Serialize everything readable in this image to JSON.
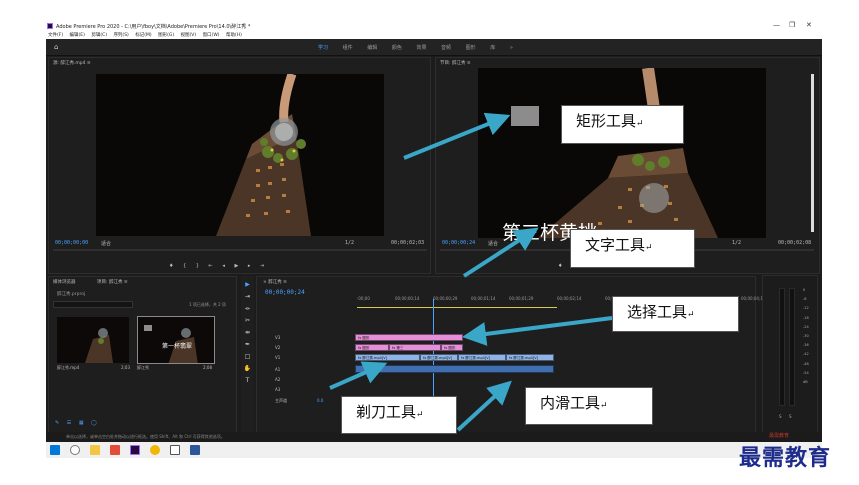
{
  "window": {
    "title": "Adobe Premiere Pro 2020 - C:\\用户\\fboy\\文档\\Adobe\\Premiere Pro\\14.0\\醉江秀 *",
    "controls": [
      "—",
      "❐",
      "✕"
    ]
  },
  "menu": [
    "文件(F)",
    "编辑(E)",
    "剪辑(C)",
    "序列(S)",
    "标记(M)",
    "图形(G)",
    "视图(V)",
    "窗口(W)",
    "帮助(H)"
  ],
  "workspace_tabs": [
    "学习",
    "组件",
    "编辑",
    "颜色",
    "效果",
    "音频",
    "图形",
    "库",
    "»"
  ],
  "source_monitor": {
    "header": "源: 醉江秀.mp4  ≡",
    "timecode_left": "00;00;00;00",
    "fit_label": "适合",
    "scale": "1/2",
    "timecode_right": "00;00;02;03"
  },
  "program_monitor": {
    "header": "节目: 醉江秀  ≡",
    "timecode_left": "00;00;00;24",
    "fit_label": "适合",
    "scale": "1/2",
    "timecode_right": "00;00;02;08",
    "overlay_text": "第三杯黄桃"
  },
  "project_panel": {
    "tabs": [
      "媒体浏览器",
      "项目: 醉江秀  ≡"
    ],
    "project_name": "醉江秀.prproj",
    "selection_info": "1 项已选择，共 2 项",
    "items": [
      {
        "name": "醉江秀.mp4",
        "duration": "2;03"
      },
      {
        "name": "醉江秀",
        "duration": "2;08",
        "overlay": "第一杯翡翠"
      }
    ]
  },
  "timeline": {
    "header": "× 醉江秀  ≡",
    "timecode": "00;00;00;24",
    "ruler": [
      ":00;00",
      "00;00;00;14",
      "00;00;00;29",
      "00;00;01;14",
      "00;00;01;29",
      "00;00;02;14",
      "00;00;02;29",
      "00;00;03;14",
      "00;00;03;29",
      "00;00;04;1"
    ],
    "tracks": [
      "V3",
      "V2",
      "V1",
      "A1",
      "A2",
      "A3",
      "主声道"
    ],
    "master_value": "0.0",
    "clips": {
      "v3": [
        "fx 图形"
      ],
      "v2": [
        "fx 图形",
        "fx 第三",
        "fx 图形"
      ],
      "v1": [
        "fx 醉江秀.mp4[V]",
        "fx 醉江秀.mp4[V]",
        "fx 醉江秀.mp4[V]",
        "fx 醉江秀.mp4[V]"
      ]
    }
  },
  "audio_meter": {
    "labels": [
      "0",
      "-6",
      "-12",
      "-18",
      "-24",
      "-30",
      "-36",
      "-42",
      "-48",
      "-54",
      "dB"
    ],
    "footer": [
      "S",
      "S"
    ]
  },
  "status_bar": "单击以选择，或单击空白处并拖动以进行框选。使用 Shift、Alt 和 Ctrl 可获得其他选项。",
  "callouts": {
    "rect": "矩形工具",
    "text": "文字工具",
    "select": "选择工具",
    "razor": "剃刀工具",
    "slide": "内滑工具",
    "return_mark": "↵"
  },
  "logo": {
    "text": "最需教育",
    "sub": "最需教育"
  },
  "colors": {
    "accent_blue": "#4aa3ff",
    "arrow": "#3aa6c8",
    "clip_pink": "#e58fd8",
    "clip_blue": "#8fb3e6"
  }
}
